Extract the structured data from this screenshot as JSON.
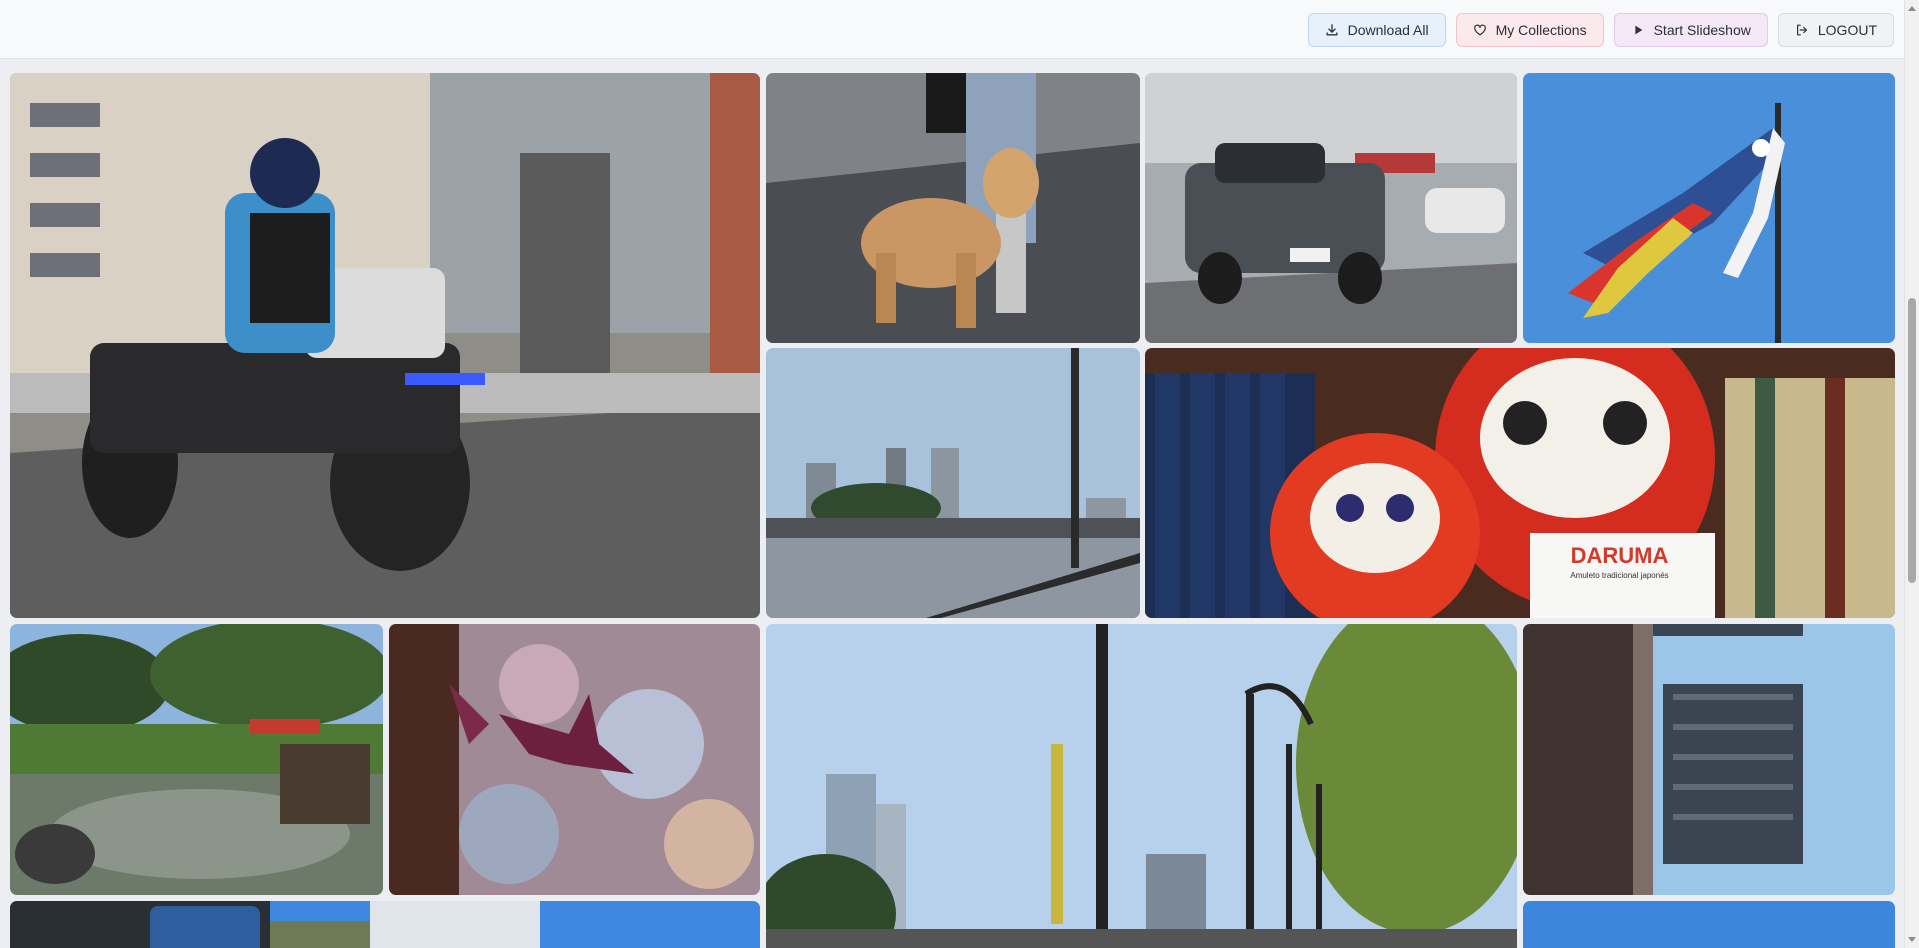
{
  "toolbar": {
    "download_all_label": "Download All",
    "download_icon": "download-icon",
    "my_collections_label": "My Collections",
    "collections_icon": "heart-icon",
    "start_slideshow_label": "Start Slideshow",
    "slideshow_icon": "play-icon",
    "logout_label": "LOGOUT",
    "logout_icon": "logout-icon"
  },
  "gallery": {
    "photos": [
      {
        "subject": "police ATV rider on city street"
      },
      {
        "subject": "long-haired dog with people on sidewalk"
      },
      {
        "subject": "grey pickup truck parked on street"
      },
      {
        "subject": "koi windsock flag on pole against blue sky"
      },
      {
        "subject": "waterfront city skyline with railing"
      },
      {
        "subject": "daruma dolls beside bookshelf",
        "sign_title": "DARUMA",
        "sign_subtitle": "Amuleto tradicional japonés"
      },
      {
        "subject": "japanese garden pond with trees"
      },
      {
        "subject": "paper crane mobile"
      },
      {
        "subject": "harbor promenade with street lamps"
      },
      {
        "subject": "tall apartment building viewed from below"
      },
      {
        "subject": "blue bus and building"
      },
      {
        "subject": "blue sky"
      }
    ]
  },
  "colors": {
    "download_bg": "#e6f1fb",
    "collections_bg": "#fbe9ee",
    "slideshow_bg": "#f4e8f7",
    "logout_bg": "#f1f2f4"
  }
}
